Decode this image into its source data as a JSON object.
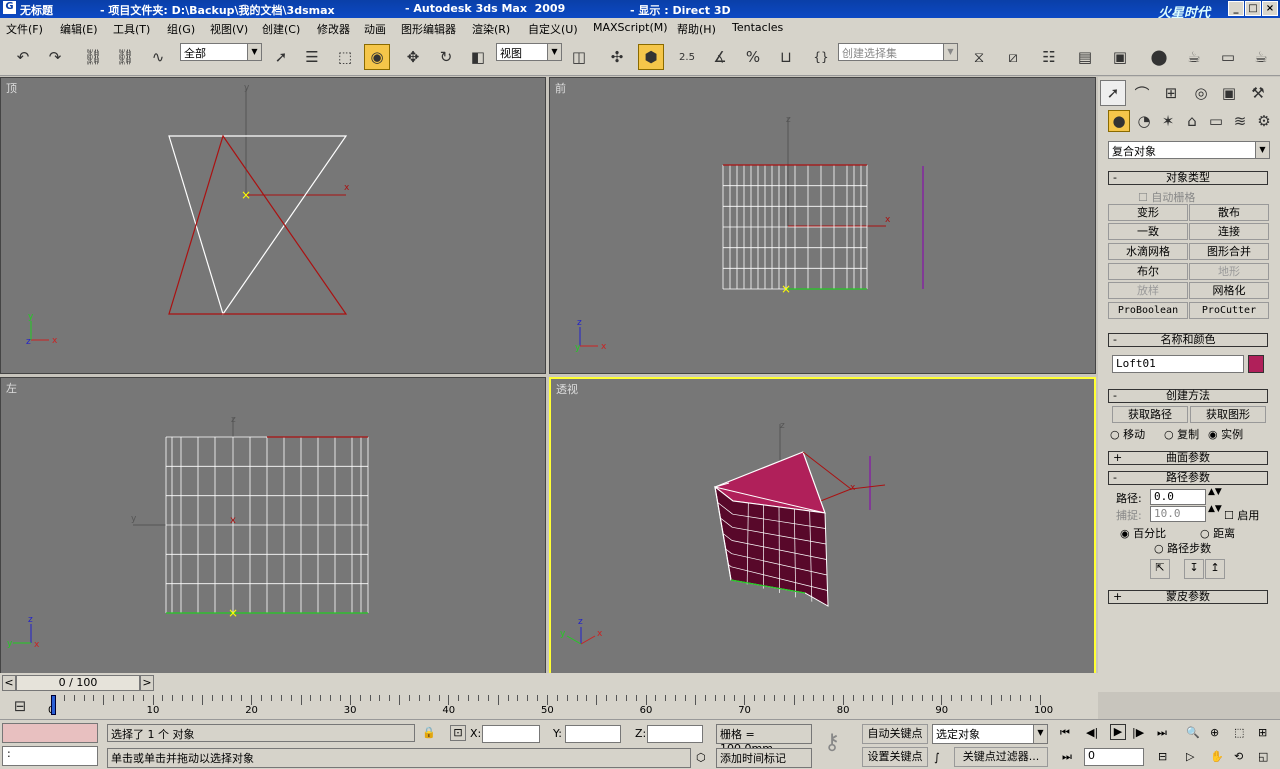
{
  "titlebar": {
    "app_title": "无标题",
    "project": "- 项目文件夹: D:\\Backup\\我的文档\\3dsmax",
    "product": "- Autodesk 3ds Max  2009",
    "display": "- 显示 : Direct 3D",
    "watermark": "火星时代"
  },
  "menu": [
    "文件(F)",
    "编辑(E)",
    "工具(T)",
    "组(G)",
    "视图(V)",
    "创建(C)",
    "修改器",
    "动画",
    "图形编辑器",
    "渲染(R)",
    "自定义(U)",
    "MAXScript(M)",
    "帮助(H)",
    "Tentacles"
  ],
  "toolbar": {
    "selection_filter": "全部",
    "ref_coord": "视图",
    "named_selection_placeholder": "创建选择集",
    "snap_angle": "2.5",
    "snap_percent": "%"
  },
  "viewports": {
    "top": "顶",
    "front": "前",
    "left": "左",
    "perspective": "透视"
  },
  "axes": {
    "x": "x",
    "y": "y",
    "z": "z"
  },
  "command_panel": {
    "category": "复合对象",
    "object_type_title": "对象类型",
    "autogrid": "自动栅格",
    "buttons": [
      "变形",
      "散布",
      "一致",
      "连接",
      "水滴网格",
      "图形合并",
      "布尔",
      "地形",
      "放样",
      "网格化",
      "ProBoolean",
      "ProCutter"
    ],
    "name_color_title": "名称和颜色",
    "object_name": "Loft01",
    "object_color": "#b0205a",
    "creation_method_title": "创建方法",
    "get_path": "获取路径",
    "get_shape": "获取图形",
    "radios": [
      "移动",
      "复制",
      "实例"
    ],
    "surface_params": "曲面参数",
    "path_params": "路径参数",
    "path_label": "路径:",
    "path_value": "0.0",
    "snap_label": "捕捉:",
    "snap_value": "10.0",
    "enable": "启用",
    "percentage": "百分比",
    "distance": "距离",
    "path_steps": "路径步数",
    "skin_params": "蒙皮参数"
  },
  "timeline": {
    "frame": "0 / 100",
    "ticks": [
      "0",
      "10",
      "20",
      "30",
      "40",
      "50",
      "60",
      "70",
      "80",
      "90",
      "100"
    ]
  },
  "status": {
    "selected": "选择了 1 个 对象",
    "prompt": "单击或单击并拖动以选择对象",
    "x_label": "X:",
    "y_label": "Y:",
    "z_label": "Z:",
    "grid": "栅格 = 100.0mm",
    "add_time_tag": "添加时间标记",
    "auto_key": "自动关键点",
    "set_key": "设置关键点",
    "key_mode": "选定对象",
    "key_filters": "关键点过滤器...",
    "current_frame": "0"
  }
}
